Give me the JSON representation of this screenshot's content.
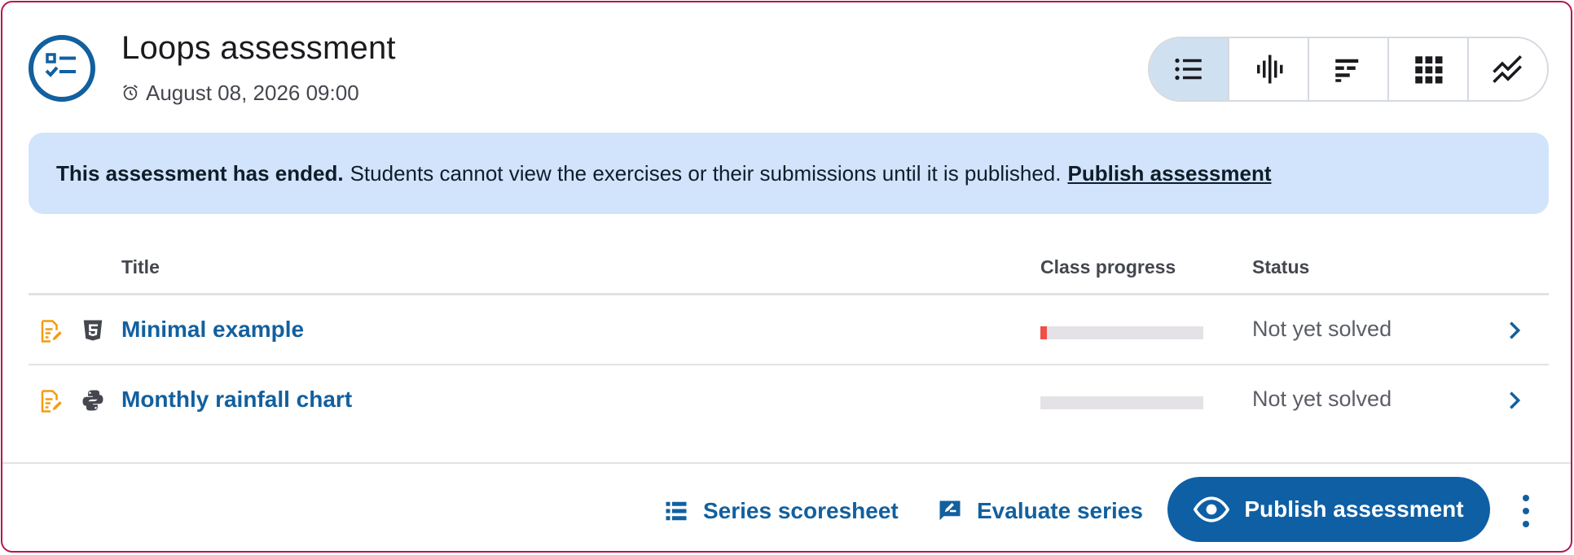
{
  "header": {
    "title": "Loops assessment",
    "deadline": "August 08, 2026 09:00",
    "views": [
      {
        "icon": "list-icon",
        "active": true
      },
      {
        "icon": "waveform-icon",
        "active": false
      },
      {
        "icon": "bar-sort-icon",
        "active": false
      },
      {
        "icon": "grid-icon",
        "active": false
      },
      {
        "icon": "trend-icon",
        "active": false
      }
    ]
  },
  "alert": {
    "strong": "This assessment has ended.",
    "message": "Students cannot view the exercises or their submissions until it is published.",
    "link": "Publish assessment"
  },
  "table": {
    "headers": {
      "title": "Title",
      "progress": "Class progress",
      "status": "Status"
    },
    "rows": [
      {
        "title": "Minimal example",
        "language": "html5-icon",
        "progress": 0.04,
        "status": "Not yet solved"
      },
      {
        "title": "Monthly rainfall chart",
        "language": "python-icon",
        "progress": 0,
        "status": "Not yet solved"
      }
    ]
  },
  "footer": {
    "scoresheet": "Series scoresheet",
    "evaluate": "Evaluate series",
    "publish": "Publish assessment"
  },
  "colors": {
    "primary": "#12609f",
    "alert_bg": "#d1e4fb",
    "border": "#b5174f",
    "progress_fill": "#f04f47",
    "edit_icon": "#f39c12"
  }
}
